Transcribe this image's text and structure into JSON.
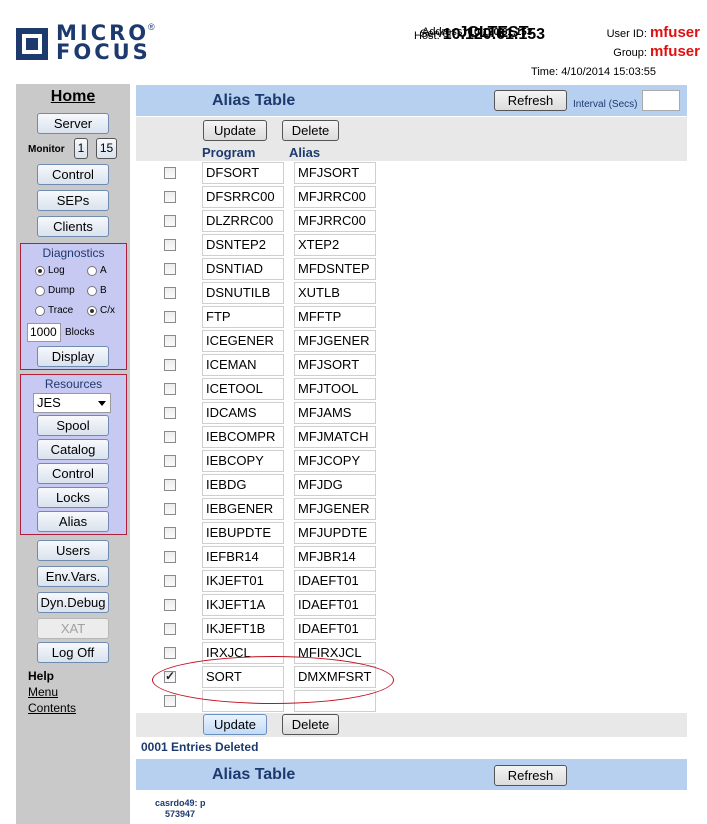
{
  "header": {
    "logo_line1": "MICRO",
    "logo_line2": "FOCUS",
    "logo_reg": "®",
    "server_label": "Server:",
    "server": "JCLTEST",
    "host_label": "Host:",
    "host": "10.120.61.153",
    "address_label": "Address:",
    "address": "10.120.61.153",
    "userid_label": "User ID:",
    "userid": "mfuser",
    "group_label": "Group:",
    "group": "mfuser",
    "time_label": "Time:",
    "time": "4/10/2014 15:03:55"
  },
  "sidebar": {
    "home": "Home",
    "server": "Server",
    "monitor_label": "Monitor",
    "monitor_1": "1",
    "monitor_15": "15",
    "control": "Control",
    "seps": "SEPs",
    "clients": "Clients",
    "diagnostics": {
      "title": "Diagnostics",
      "log": "Log",
      "a": "A",
      "dump": "Dump",
      "b": "B",
      "trace": "Trace",
      "cx": "C/x",
      "blocks_value": "1000",
      "blocks_label": "Blocks",
      "display": "Display"
    },
    "resources": {
      "title": "Resources",
      "selected": "JES",
      "spool": "Spool",
      "catalog": "Catalog",
      "control": "Control",
      "locks": "Locks",
      "alias": "Alias"
    },
    "users": "Users",
    "env_vars": "Env.Vars.",
    "dyn_debug": "Dyn.Debug",
    "xat": "XAT",
    "log_off": "Log Off",
    "help": "Help",
    "menu": "Menu",
    "contents": "Contents"
  },
  "main": {
    "title": "Alias Table",
    "refresh": "Refresh",
    "interval_label": "Interval (Secs)",
    "update": "Update",
    "delete": "Delete",
    "col_program": "Program",
    "col_alias": "Alias",
    "rows": [
      {
        "program": "DFSORT",
        "alias": "MFJSORT",
        "checked": false
      },
      {
        "program": "DFSRRC00",
        "alias": "MFJRRC00",
        "checked": false
      },
      {
        "program": "DLZRRC00",
        "alias": "MFJRRC00",
        "checked": false
      },
      {
        "program": "DSNTEP2",
        "alias": "XTEP2",
        "checked": false
      },
      {
        "program": "DSNTIAD",
        "alias": "MFDSNTEP",
        "checked": false
      },
      {
        "program": "DSNUTILB",
        "alias": "XUTLB",
        "checked": false
      },
      {
        "program": "FTP",
        "alias": "MFFTP",
        "checked": false
      },
      {
        "program": "ICEGENER",
        "alias": "MFJGENER",
        "checked": false
      },
      {
        "program": "ICEMAN",
        "alias": "MFJSORT",
        "checked": false
      },
      {
        "program": "ICETOOL",
        "alias": "MFJTOOL",
        "checked": false
      },
      {
        "program": "IDCAMS",
        "alias": "MFJAMS",
        "checked": false
      },
      {
        "program": "IEBCOMPR",
        "alias": "MFJMATCH",
        "checked": false
      },
      {
        "program": "IEBCOPY",
        "alias": "MFJCOPY",
        "checked": false
      },
      {
        "program": "IEBDG",
        "alias": "MFJDG",
        "checked": false
      },
      {
        "program": "IEBGENER",
        "alias": "MFJGENER",
        "checked": false
      },
      {
        "program": "IEBUPDTE",
        "alias": "MFJUPDTE",
        "checked": false
      },
      {
        "program": "IEFBR14",
        "alias": "MFJBR14",
        "checked": false
      },
      {
        "program": "IKJEFT01",
        "alias": "IDAEFT01",
        "checked": false
      },
      {
        "program": "IKJEFT1A",
        "alias": "IDAEFT01",
        "checked": false
      },
      {
        "program": "IKJEFT1B",
        "alias": "IDAEFT01",
        "checked": false
      },
      {
        "program": "IRXJCL",
        "alias": "MFIRXJCL",
        "checked": false
      },
      {
        "program": "SORT",
        "alias": "DMXMFSRT",
        "checked": true
      },
      {
        "program": "",
        "alias": "",
        "checked": false
      }
    ],
    "entries_deleted": "0001 Entries Deleted",
    "footer_line1": "casrdo49: p",
    "footer_line2": "573947"
  }
}
